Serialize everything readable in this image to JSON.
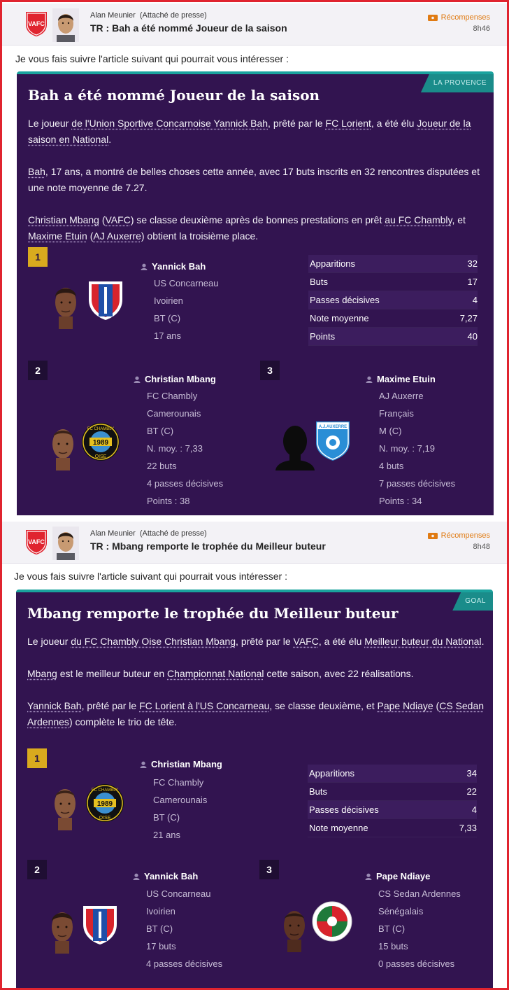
{
  "messages": [
    {
      "sender_name": "Alan Meunier",
      "sender_role": "(Attaché de presse)",
      "subject": "TR : Bah a été nommé Joueur de la saison",
      "reward_link": "Récompenses",
      "time": "8h46",
      "intro": "Je vous fais suivre l'article suivant qui pourrait vous intéresser :",
      "article": {
        "source": "LA PROVENCE",
        "title": "Bah a été nommé Joueur de la saison",
        "p1": [
          "Le joueur ",
          "de l'Union Sportive Concarnoise Yannick Bah",
          ", prêté par le ",
          "FC Lorient",
          ", a été élu ",
          "Joueur de la saison en National",
          "."
        ],
        "p2": [
          "Bah",
          ", 17 ans, a montré de belles choses cette année, avec 17 buts inscrits en 32 rencontres disputées et une note moyenne de 7.27."
        ],
        "p3": [
          "Christian Mbang",
          " (",
          "VAFC",
          ") se classe deuxième après de bonnes prestations en prêt ",
          "au FC Chambly",
          ", et ",
          "Maxime Etuin",
          " (",
          "AJ Auxerre",
          ") obtient la troisième place."
        ],
        "winner": {
          "rank": "1",
          "name": "Yannick Bah",
          "club": "US Concarneau",
          "nationality": "Ivoirien",
          "position": "BT (C)",
          "age": "17 ans",
          "stats": [
            {
              "label": "Apparitions",
              "value": "32"
            },
            {
              "label": "Buts",
              "value": "17"
            },
            {
              "label": "Passes décisives",
              "value": "4"
            },
            {
              "label": "Note moyenne",
              "value": "7,27"
            },
            {
              "label": "Points",
              "value": "40"
            }
          ]
        },
        "second": {
          "rank": "2",
          "name": "Christian Mbang",
          "club": "FC Chambly",
          "nationality": "Camerounais",
          "position": "BT (C)",
          "rating": "N. moy. : 7,33",
          "goals": "22 buts",
          "assists": "4 passes décisives",
          "points": "Points : 38"
        },
        "third": {
          "rank": "3",
          "name": "Maxime Etuin",
          "club": "AJ Auxerre",
          "nationality": "Français",
          "position": "M (C)",
          "rating": "N. moy. : 7,19",
          "goals": "4 buts",
          "assists": "7 passes décisives",
          "points": "Points : 34"
        }
      }
    },
    {
      "sender_name": "Alan Meunier",
      "sender_role": "(Attaché de presse)",
      "subject": "TR : Mbang remporte le trophée du Meilleur buteur",
      "reward_link": "Récompenses",
      "time": "8h48",
      "intro": "Je vous fais suivre l'article suivant qui pourrait vous intéresser :",
      "article": {
        "source": "GOAL",
        "title": "Mbang remporte le trophée du Meilleur buteur",
        "p1": [
          "Le joueur ",
          "du FC Chambly Oise Christian Mbang",
          ", prêté par le ",
          "VAFC",
          ", a été élu ",
          "Meilleur buteur du National",
          "."
        ],
        "p2": [
          "Mbang",
          " est le meilleur buteur en ",
          "Championnat National",
          " cette saison, avec 22 réalisations."
        ],
        "p3": [
          "Yannick Bah",
          ", prêté par le ",
          "FC Lorient à l'US Concarneau",
          ", se classe deuxième, et ",
          "Pape Ndiaye",
          " (",
          "CS Sedan Ardennes",
          ") complète le trio de tête."
        ],
        "winner": {
          "rank": "1",
          "name": "Christian Mbang",
          "club": "FC Chambly",
          "nationality": "Camerounais",
          "position": "BT (C)",
          "age": "21 ans",
          "stats": [
            {
              "label": "Apparitions",
              "value": "34"
            },
            {
              "label": "Buts",
              "value": "22"
            },
            {
              "label": "Passes décisives",
              "value": "4"
            },
            {
              "label": "Note moyenne",
              "value": "7,33"
            }
          ]
        },
        "second": {
          "rank": "2",
          "name": "Yannick Bah",
          "club": "US Concarneau",
          "nationality": "Ivoirien",
          "position": "BT (C)",
          "goals": "17 buts",
          "assists": "4 passes décisives"
        },
        "third": {
          "rank": "3",
          "name": "Pape Ndiaye",
          "club": "CS Sedan Ardennes",
          "nationality": "Sénégalais",
          "position": "BT (C)",
          "goals": "15 buts",
          "assists": "0 passes décisives"
        }
      }
    }
  ],
  "crest_texts": {
    "vafc": "VAFC",
    "chambly_top": "FC CHAMBLY",
    "chambly_year": "1989",
    "chambly_bottom": "OISE",
    "auxerre": "A.J.AUXERRE"
  },
  "colors": {
    "article_bg": "#321450",
    "accent_teal": "#1aa39e",
    "rank_gold": "#d9aa1e",
    "reward_orange": "#e07b13",
    "frame_red": "#e0242f"
  }
}
